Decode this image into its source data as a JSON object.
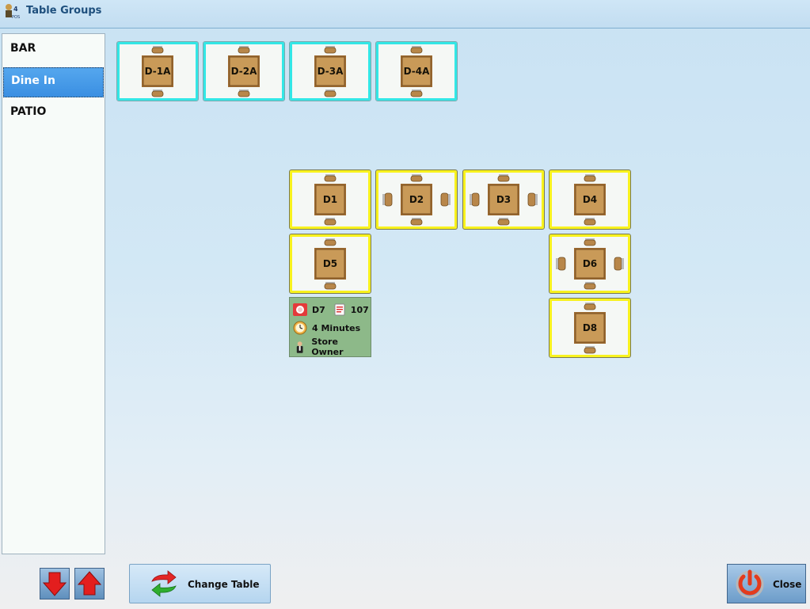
{
  "window": {
    "title": "Table Groups",
    "app_icon": "4pos-logo-icon"
  },
  "groups": [
    {
      "label": "BAR",
      "selected": false
    },
    {
      "label": "Dine In",
      "selected": true
    },
    {
      "label": "PATIO",
      "selected": false
    }
  ],
  "tables": [
    {
      "label": "D-1A",
      "style": "cyan",
      "side_seats": false
    },
    {
      "label": "D-2A",
      "style": "cyan",
      "side_seats": false
    },
    {
      "label": "D-3A",
      "style": "cyan",
      "side_seats": false
    },
    {
      "label": "D-4A",
      "style": "cyan",
      "side_seats": false
    },
    {
      "label": "D1",
      "style": "yellow",
      "side_seats": false
    },
    {
      "label": "D2",
      "style": "yellow",
      "side_seats": true
    },
    {
      "label": "D3",
      "style": "yellow",
      "side_seats": true
    },
    {
      "label": "D4",
      "style": "yellow",
      "side_seats": false
    },
    {
      "label": "D5",
      "style": "yellow",
      "side_seats": false
    },
    {
      "label": "D6",
      "style": "yellow",
      "side_seats": true
    },
    {
      "label": "D8",
      "style": "yellow",
      "side_seats": false
    }
  ],
  "occupied_table": {
    "table": "D7",
    "check_number": "107",
    "duration": "4 Minutes",
    "server": "Store Owner",
    "icons": [
      "plate-icon",
      "order-ticket-icon",
      "clock-icon",
      "waiter-icon"
    ]
  },
  "buttons": {
    "scroll_down_icon": "arrow-down-icon",
    "scroll_up_icon": "arrow-up-icon",
    "change_table": "Change Table",
    "close": "Close"
  },
  "colors": {
    "available_border": "#f8f21e",
    "reserved_border": "#33e7e6",
    "occupied_fill": "#8db989",
    "selected_group": "#3a8fe2"
  }
}
